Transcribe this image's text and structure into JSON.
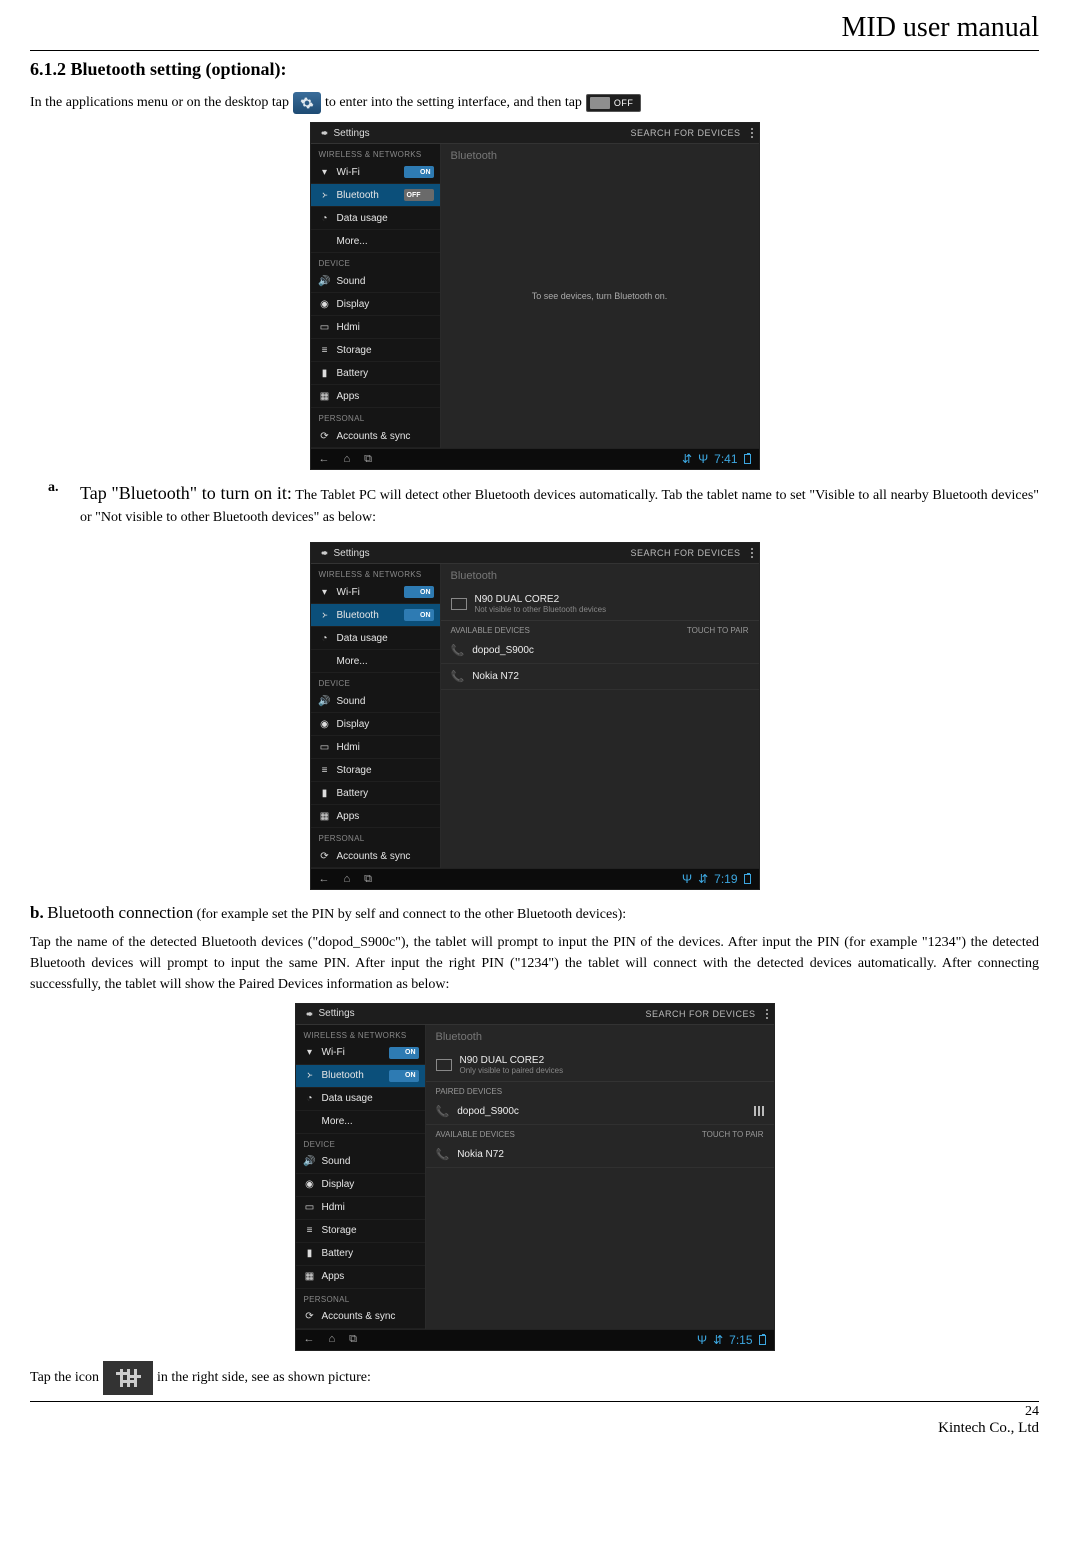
{
  "header": {
    "title": "MID user manual"
  },
  "section": {
    "heading": "6.1.2 Bluetooth setting (optional):"
  },
  "intro": {
    "part1": "In the applications menu or on the desktop tap",
    "part2": "to enter into the setting interface, and then tap",
    "off_label": "OFF"
  },
  "item_a": {
    "marker": "a.",
    "lead": "Tap \"Bluetooth\" to turn on it:",
    "rest": "The Tablet PC will detect other Bluetooth devices automatically. Tab the tablet name to set \"Visible to all nearby Bluetooth devices\" or \"Not visible to other Bluetooth devices\" as below:"
  },
  "item_b": {
    "lead_bold": "b.",
    "lead_big": "Bluetooth connection",
    "lead_rest": "(for example set the PIN by self and connect to the other Bluetooth devices):",
    "para": "Tap the name of the detected Bluetooth devices (\"dopod_S900c\"), the tablet will prompt to input the PIN of the devices. After input the PIN (for example \"1234\") the detected Bluetooth devices will prompt to input the same PIN. After input the right PIN (\"1234\") the tablet will connect with the detected devices automatically. After connecting successfully, the tablet will show the Paired Devices information as below:"
  },
  "tail": {
    "part1": "Tap the icon",
    "part2": "in the right side, see as shown picture:"
  },
  "footer": {
    "page": "24",
    "company": "Kintech Co., Ltd"
  },
  "settings_ui": {
    "title": "Settings",
    "search": "SEARCH FOR DEVICES",
    "main_label": "Bluetooth",
    "categories": {
      "wireless": "WIRELESS & NETWORKS",
      "device": "DEVICE",
      "personal": "PERSONAL"
    },
    "side": {
      "wifi": "Wi-Fi",
      "bluetooth": "Bluetooth",
      "data": "Data usage",
      "more": "More...",
      "sound": "Sound",
      "display": "Display",
      "hdmi": "Hdmi",
      "storage": "Storage",
      "battery": "Battery",
      "apps": "Apps",
      "accounts": "Accounts & sync"
    },
    "shot1": {
      "center_msg": "To see devices, turn Bluetooth on.",
      "clock": "7:41"
    },
    "shot2": {
      "self_name": "N90 DUAL CORE2",
      "self_sub": "Not visible to other Bluetooth devices",
      "avail_hdr": "AVAILABLE DEVICES",
      "touch_hdr": "TOUCH TO PAIR",
      "dev1": "dopod_S900c",
      "dev2": "Nokia N72",
      "clock": "7:19"
    },
    "shot3": {
      "self_name": "N90 DUAL CORE2",
      "self_sub": "Only visible to paired devices",
      "paired_hdr": "PAIRED DEVICES",
      "dev_paired": "dopod_S900c",
      "avail_hdr": "AVAILABLE DEVICES",
      "touch_hdr": "TOUCH TO PAIR",
      "dev_avail": "Nokia N72",
      "clock": "7:15"
    }
  }
}
